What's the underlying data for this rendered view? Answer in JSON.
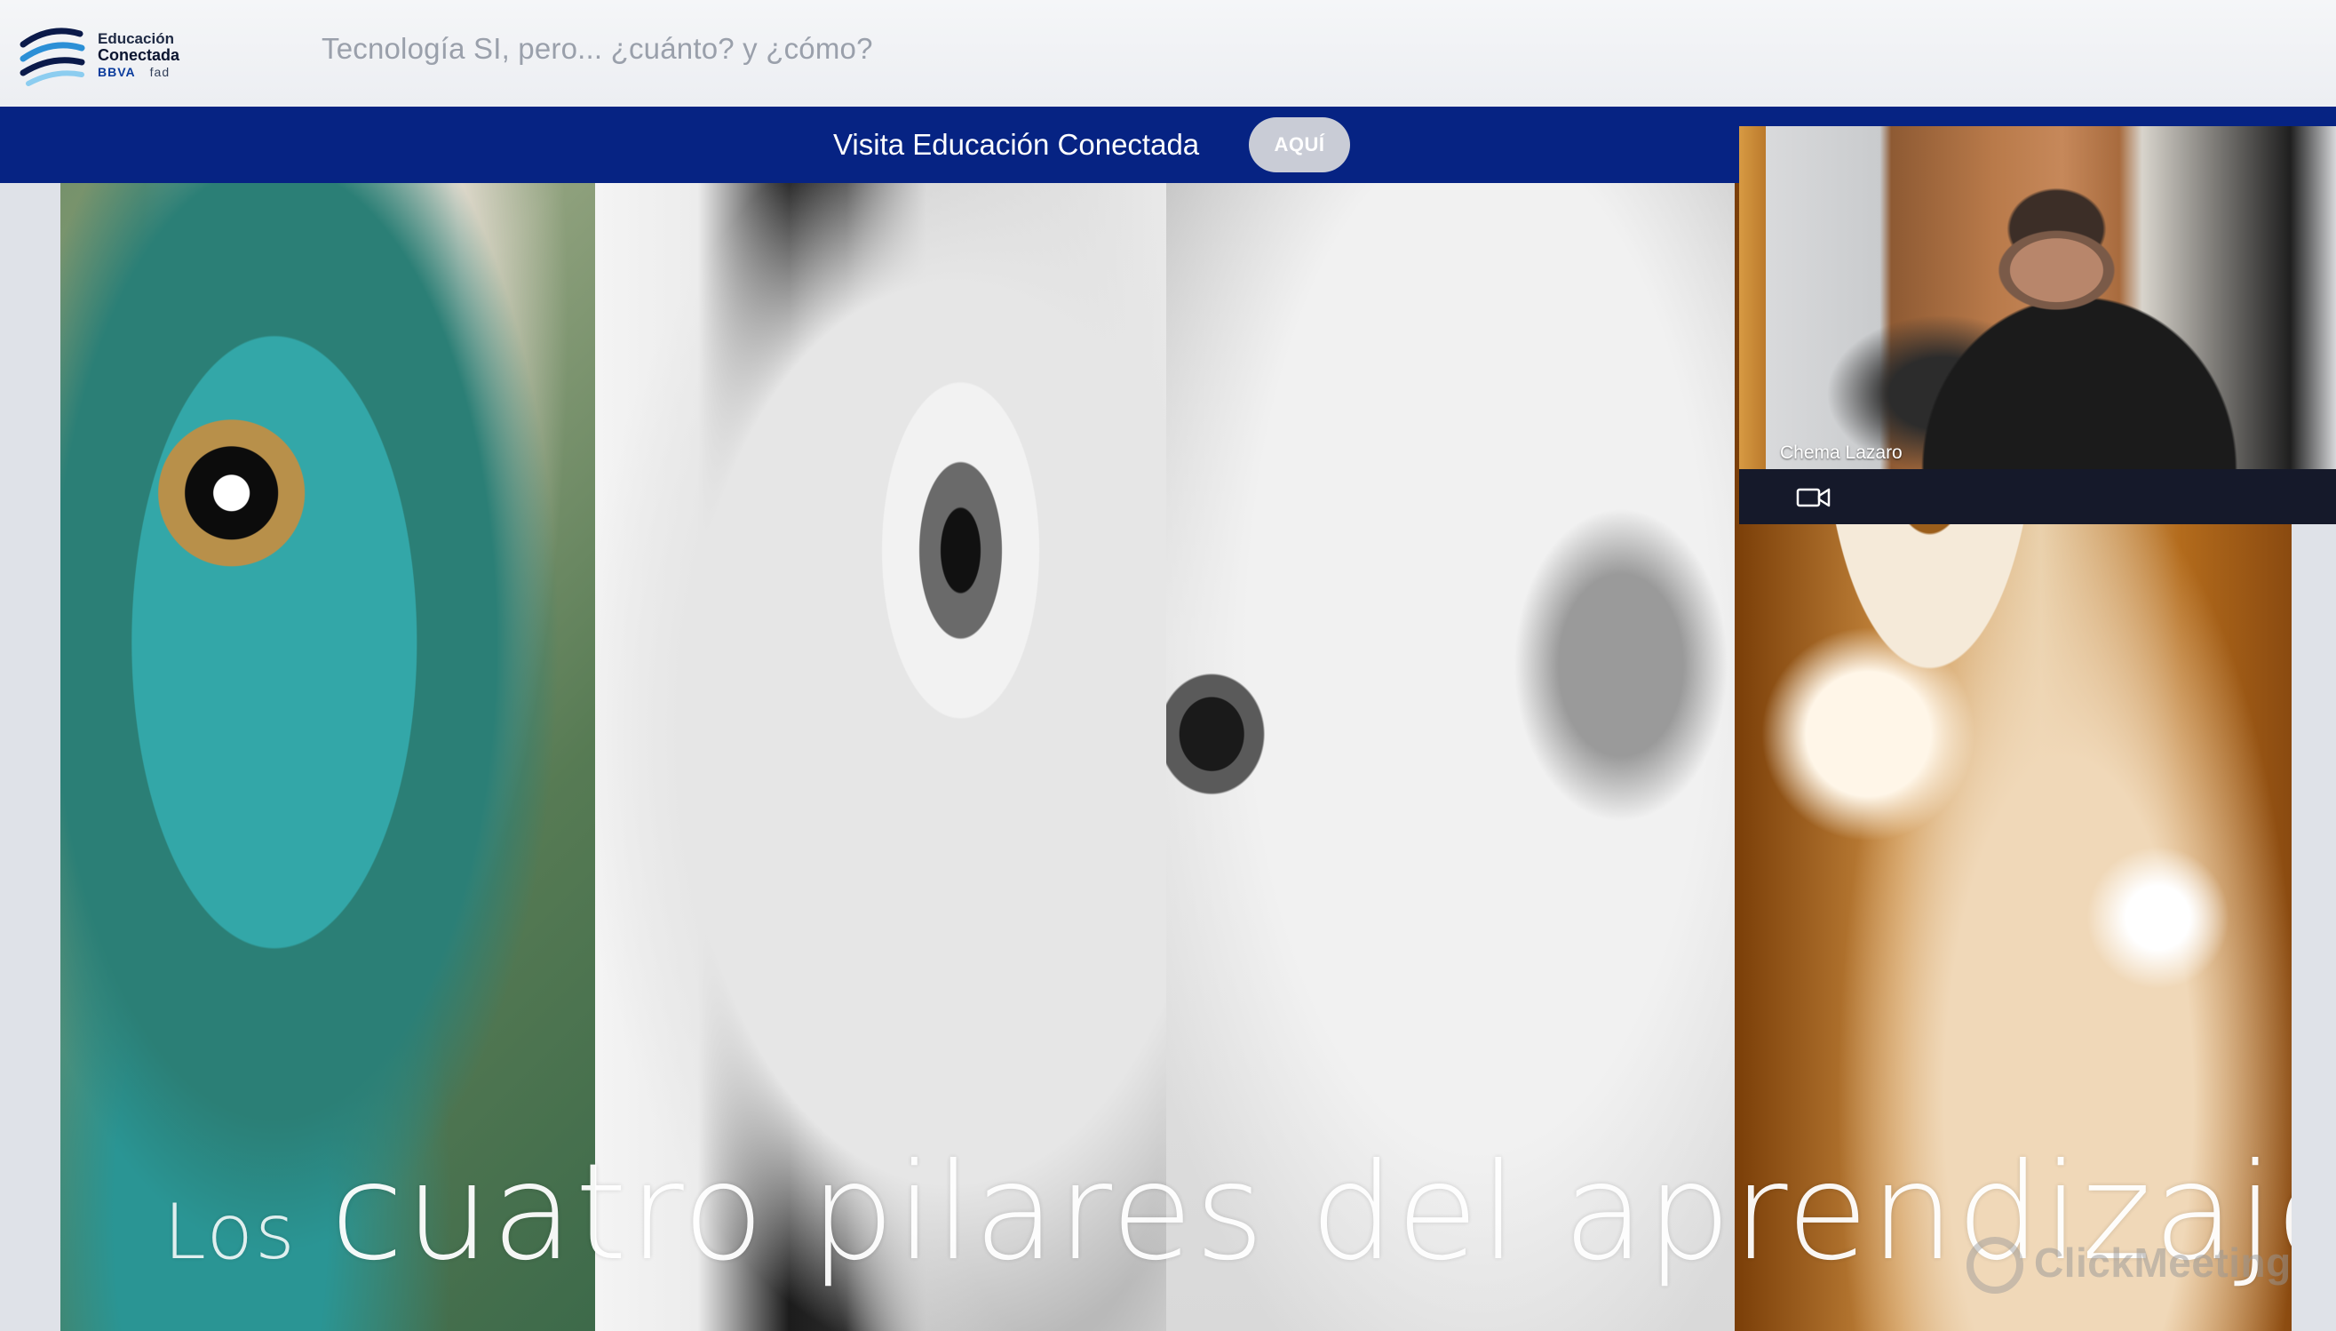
{
  "header": {
    "logo": {
      "line1": "Educación",
      "line2": "Conectada",
      "brand_bbva": "BBVA",
      "brand_fad": "fad",
      "colors": {
        "stripe_dark": "#0b1a4a",
        "stripe_blue": "#2b8fd6",
        "stripe_light": "#8ccdf0"
      }
    },
    "webinar_title": "Tecnología SI, pero... ¿cuánto? y ¿cómo?"
  },
  "promo_bar": {
    "text": "Visita Educación Conectada",
    "button_label": "AQUÍ",
    "color": "#062383"
  },
  "slide": {
    "title_los": "Los",
    "title_main": "cuatro pilares del aprendizaje",
    "panels": [
      "chameleon-eye",
      "girl-looking-sideways",
      "boy-shouting",
      "amber-eye"
    ],
    "watermark": "ClickMeeting"
  },
  "webcam": {
    "participant_name": "Chema Lazaro",
    "camera_icon": "video-camera-icon"
  }
}
